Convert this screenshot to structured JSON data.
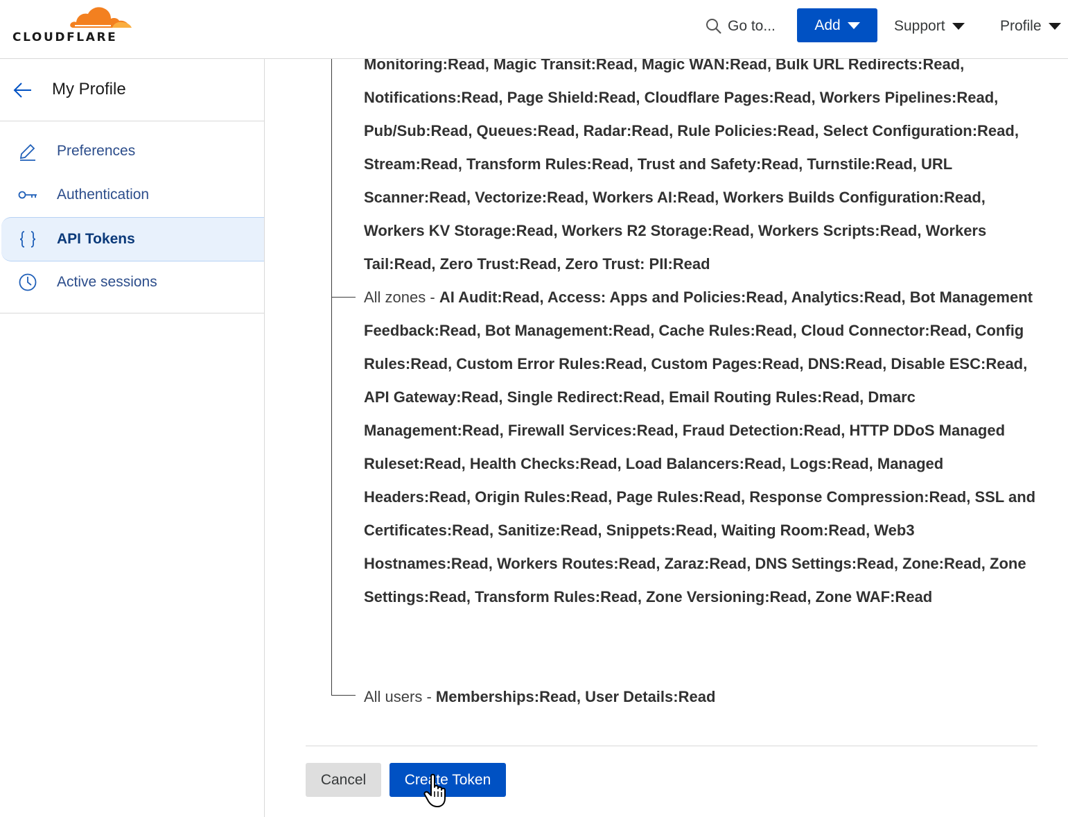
{
  "header": {
    "logo_text": "CLOUDFLARE",
    "goto_label": "Go to...",
    "add_label": "Add",
    "support_label": "Support",
    "profile_label": "Profile",
    "accent_color": "#0051c3",
    "logo_color": "#f38020"
  },
  "sidebar": {
    "title": "My Profile",
    "back_icon": "arrow-left-icon",
    "items": [
      {
        "label": "Preferences",
        "icon": "pencil-icon",
        "active": false
      },
      {
        "label": "Authentication",
        "icon": "key-icon",
        "active": false
      },
      {
        "label": "API Tokens",
        "icon": "braces-icon",
        "active": true
      },
      {
        "label": "Active sessions",
        "icon": "clock-icon",
        "active": false
      }
    ]
  },
  "main": {
    "permission_groups": [
      {
        "scope": "",
        "permissions": "Monitoring:Read, Magic Transit:Read, Magic WAN:Read, Bulk URL Redirects:Read, Notifications:Read, Page Shield:Read, Cloudflare Pages:Read, Workers Pipelines:Read, Pub/Sub:Read, Queues:Read, Radar:Read, Rule Policies:Read, Select Configuration:Read, Stream:Read, Transform Rules:Read, Trust and Safety:Read, Turnstile:Read, URL Scanner:Read, Vectorize:Read, Workers AI:Read, Workers Builds Configuration:Read, Workers KV Storage:Read, Workers R2 Storage:Read, Workers Scripts:Read, Workers Tail:Read, Zero Trust:Read, Zero Trust: PII:Read"
      },
      {
        "scope": "All zones - ",
        "permissions": "AI Audit:Read, Access: Apps and Policies:Read, Analytics:Read, Bot Management Feedback:Read, Bot Management:Read, Cache Rules:Read, Cloud Connector:Read, Config Rules:Read, Custom Error Rules:Read, Custom Pages:Read, DNS:Read, Disable ESC:Read, API Gateway:Read, Single Redirect:Read, Email Routing Rules:Read, Dmarc Management:Read, Firewall Services:Read, Fraud Detection:Read, HTTP DDoS Managed Ruleset:Read, Health Checks:Read, Load Balancers:Read, Logs:Read, Managed Headers:Read, Origin Rules:Read, Page Rules:Read, Response Compression:Read, SSL and Certificates:Read, Sanitize:Read, Snippets:Read, Waiting Room:Read, Web3 Hostnames:Read, Workers Routes:Read, Zaraz:Read, DNS Settings:Read, Zone:Read, Zone Settings:Read, Transform Rules:Read, Zone Versioning:Read, Zone WAF:Read"
      },
      {
        "scope": "All users - ",
        "permissions": "Memberships:Read, User Details:Read"
      }
    ],
    "cancel_label": "Cancel",
    "create_label": "Create Token"
  }
}
